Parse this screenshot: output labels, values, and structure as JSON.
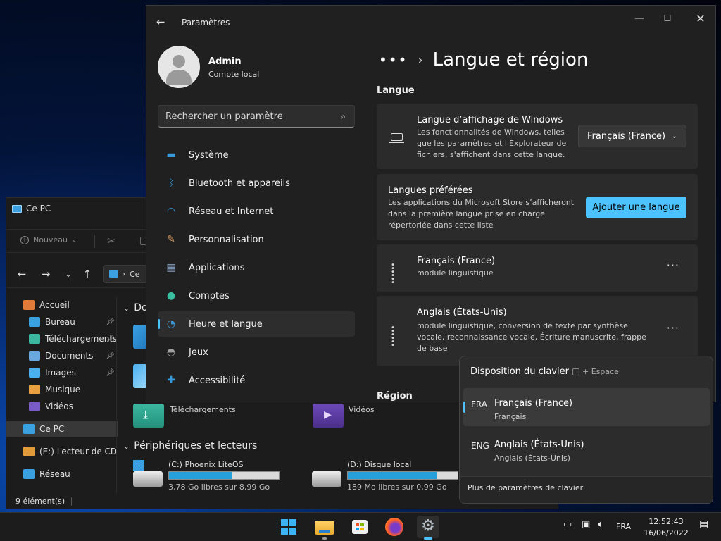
{
  "explorer": {
    "title": "Ce PC",
    "new_label": "Nouveau",
    "address": "Ce",
    "nav": [
      {
        "label": "Accueil",
        "icon": "home-icon",
        "pinned": false
      },
      {
        "label": "Bureau",
        "icon": "desktop-icon",
        "pinned": true
      },
      {
        "label": "Téléchargements",
        "icon": "download-icon",
        "pinned": true
      },
      {
        "label": "Documents",
        "icon": "document-icon",
        "pinned": true
      },
      {
        "label": "Images",
        "icon": "image-icon",
        "pinned": true
      },
      {
        "label": "Musique",
        "icon": "music-icon",
        "pinned": false
      },
      {
        "label": "Vidéos",
        "icon": "video-icon",
        "pinned": false
      },
      {
        "label": "Ce PC",
        "icon": "pc-icon",
        "pinned": false
      },
      {
        "label": "(E:) Lecteur de CD -",
        "icon": "cd-icon",
        "pinned": false
      },
      {
        "label": "Réseau",
        "icon": "network-icon",
        "pinned": false
      }
    ],
    "section_folders": "Do",
    "downloads_label": "Téléchargements",
    "videos_label": "Vidéos",
    "section_drives": "Périphériques et lecteurs",
    "drives": [
      {
        "label": "(C:) Phoenix LiteOS",
        "free": "3,78 Go libres sur 8,99 Go",
        "used_fraction": 0.58
      },
      {
        "label": "(D:) Disque local",
        "free": "189 Mo libres sur 0,99 Go",
        "used_fraction": 0.81
      }
    ],
    "status": "9 élément(s)"
  },
  "settings": {
    "app_title": "Paramètres",
    "user_name": "Admin",
    "user_type": "Compte local",
    "search_placeholder": "Rechercher un paramètre",
    "nav": [
      {
        "label": "Système",
        "icon": "system-icon",
        "color": "#3a9bdc"
      },
      {
        "label": "Bluetooth et appareils",
        "icon": "bluetooth-icon",
        "color": "#3a9bdc"
      },
      {
        "label": "Réseau et Internet",
        "icon": "wifi-icon",
        "color": "#3a9bdc"
      },
      {
        "label": "Personnalisation",
        "icon": "brush-icon",
        "color": "#e0a060"
      },
      {
        "label": "Applications",
        "icon": "apps-icon",
        "color": "#8aa0c0"
      },
      {
        "label": "Comptes",
        "icon": "account-icon",
        "color": "#3ac0a0"
      },
      {
        "label": "Heure et langue",
        "icon": "clock-globe-icon",
        "color": "#3a9bdc"
      },
      {
        "label": "Jeux",
        "icon": "gamepad-icon",
        "color": "#a0a0a0"
      },
      {
        "label": "Accessibilité",
        "icon": "accessibility-icon",
        "color": "#3a9bdc"
      }
    ],
    "selected_nav": 6,
    "crumb_dots": "•••",
    "page_title": "Langue et région",
    "section_language": "Langue",
    "display_lang": {
      "title": "Langue d’affichage de Windows",
      "desc": [
        "Les fonctionnalités de Windows, telles",
        "que les paramètres et l'Explorateur de",
        "fichiers, s'affichent dans cette langue."
      ],
      "value": "Français (France)"
    },
    "preferred": {
      "title": "Langues préférées",
      "desc": [
        "Les applications du Microsoft Store s’afficheront",
        "dans la première langue prise en charge",
        "répertoriée dans cette liste"
      ],
      "button": "Ajouter une langue"
    },
    "languages": [
      {
        "name": "Français (France)",
        "desc": [
          "module linguistique"
        ]
      },
      {
        "name": "Anglais (États-Unis)",
        "desc": [
          "module linguistique, conversion de texte par synthèse",
          "vocale, reconnaissance vocale, Écriture manuscrite, frappe",
          "de base"
        ]
      }
    ],
    "section_region": "Région"
  },
  "keyboard": {
    "title": "Disposition du clavier",
    "hint": "+ Espace",
    "options": [
      {
        "code": "FRA",
        "name": "Français (France)",
        "sub": "Français"
      },
      {
        "code": "ENG",
        "name": "Anglais (États-Unis)",
        "sub": "Anglais (États-Unis)"
      }
    ],
    "more": "Plus de paramètres de clavier"
  },
  "taskbar": {
    "apps": [
      "start-icon",
      "file-explorer-icon",
      "store-icon",
      "firefox-icon",
      "settings-icon"
    ],
    "lang": "FRA",
    "time": "12:52:43",
    "date": "16/06/2022"
  },
  "accent": "#4cc2ff"
}
